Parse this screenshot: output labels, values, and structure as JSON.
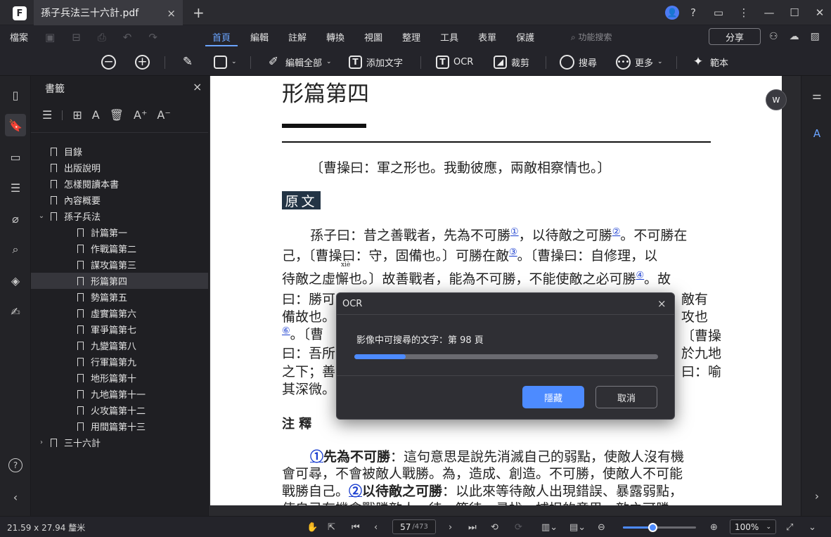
{
  "titlebar": {
    "logo": "F",
    "doc_tab": "孫子兵法三十六計.pdf",
    "tab_close": "×",
    "new_tab": "+",
    "avatar": "👤",
    "help": "?",
    "feedback": "▭",
    "more": "⋮",
    "minimize": "—",
    "maximize": "☐",
    "close": "✕"
  },
  "menubar": {
    "file": "檔案",
    "tabs": [
      {
        "label": "首頁"
      },
      {
        "label": "編輯"
      },
      {
        "label": "註解"
      },
      {
        "label": "轉換"
      },
      {
        "label": "視圖"
      },
      {
        "label": "整理"
      },
      {
        "label": "工具"
      },
      {
        "label": "表單"
      },
      {
        "label": "保護"
      }
    ],
    "active_tab": "首頁",
    "search_placeholder": "功能搜索",
    "share": "分享"
  },
  "toolbar": {
    "zoom_out": "−",
    "zoom_in": "+",
    "edit_all": "編輯全部",
    "add_text": "添加文字",
    "ocr": "OCR",
    "crop": "裁剪",
    "search": "搜尋",
    "more": "更多",
    "template": "範本"
  },
  "sidebar": {
    "title": "書籤",
    "close": "×",
    "bookmarks": [
      {
        "label": "目錄",
        "level": 0,
        "arrow": ""
      },
      {
        "label": "出版說明",
        "level": 0,
        "arrow": ""
      },
      {
        "label": "怎樣閱讀本書",
        "level": 0,
        "arrow": ""
      },
      {
        "label": "內容概要",
        "level": 0,
        "arrow": ""
      },
      {
        "label": "孫子兵法",
        "level": 0,
        "arrow": "⌄"
      },
      {
        "label": "計篇第一",
        "level": 1,
        "arrow": ""
      },
      {
        "label": "作戰篇第二",
        "level": 1,
        "arrow": ""
      },
      {
        "label": "謀攻篇第三",
        "level": 1,
        "arrow": ""
      },
      {
        "label": "形篇第四",
        "level": 1,
        "arrow": "",
        "selected": true
      },
      {
        "label": "勢篇第五",
        "level": 1,
        "arrow": ""
      },
      {
        "label": "虛實篇第六",
        "level": 1,
        "arrow": ""
      },
      {
        "label": "軍爭篇第七",
        "level": 1,
        "arrow": ""
      },
      {
        "label": "九變篇第八",
        "level": 1,
        "arrow": ""
      },
      {
        "label": "行軍篇第九",
        "level": 1,
        "arrow": ""
      },
      {
        "label": "地形篇第十",
        "level": 1,
        "arrow": ""
      },
      {
        "label": "九地篇第十一",
        "level": 1,
        "arrow": ""
      },
      {
        "label": "火攻篇第十二",
        "level": 1,
        "arrow": ""
      },
      {
        "label": "用間篇第十三",
        "level": 1,
        "arrow": ""
      },
      {
        "label": "三十六計",
        "level": 0,
        "arrow": "›"
      }
    ]
  },
  "page": {
    "title": "形篇第四",
    "commentary": "〔曹操曰：軍之形也。我動彼應，兩敵相察情也。〕",
    "section_label": "原文",
    "body": [
      {
        "a": "孫子曰：昔之善戰者，先為不可勝",
        "n1": "①",
        "b": "，以待敵之可勝",
        "n2": "②",
        "c": "。不可勝在"
      },
      {
        "a": "己，〔曹操曰：守，固備也。〕可勝在敵",
        "n1": "③",
        "b": "。〔曹操曰：自修理，以"
      },
      {
        "a": "待敵之虛懈也。〕故善戰者，能為不可勝，不能使敵之必可勝",
        "n1": "④",
        "b": "。故"
      },
      {
        "a": "曰：勝可",
        "b": "敵有"
      },
      {
        "a": "備故也。",
        "b": "攻也"
      },
      {
        "n1": "⑥",
        "a": "。〔曹",
        "b": "〔曹操"
      },
      {
        "a": "曰：吾所",
        "b": "於九地"
      },
      {
        "a": "之下；善",
        "b": "曰：喻"
      },
      {
        "a": "其深微。"
      }
    ],
    "ruby": "xiè",
    "notes_label": "注 釋",
    "notes": [
      {
        "ref": "①",
        "term": "先為不可勝",
        "text": "：這句意思是說先消滅自己的弱點，使敵人沒有機"
      },
      {
        "text": "會可尋，不會被敵人戰勝。為，造成、創造。不可勝，使敵人不可能"
      },
      {
        "a": "戰勝自己。",
        "ref": "②",
        "term": "以待敵之可勝",
        "text": "：以此來等待敵人出現錯誤、暴露弱點，"
      },
      {
        "text": "使自己有機會戰勝敵人。待，等待、尋找、捕捉的意思。敵之可勝，"
      }
    ]
  },
  "ocr_dialog": {
    "title": "OCR",
    "close": "×",
    "message": "影像中可搜尋的文字：第 98 頁",
    "progress": 0.17,
    "hide": "隱藏",
    "cancel": "取消"
  },
  "statusbar": {
    "page_size": "21.59 x 27.94 釐米",
    "current_page": "57",
    "total_pages": "/473",
    "zoom": "100%",
    "zoom_level": 0.4
  },
  "colors": {
    "accent": "#4d8bff",
    "active_tab": "#6aa4ff",
    "section_label_bg": "#233445"
  }
}
